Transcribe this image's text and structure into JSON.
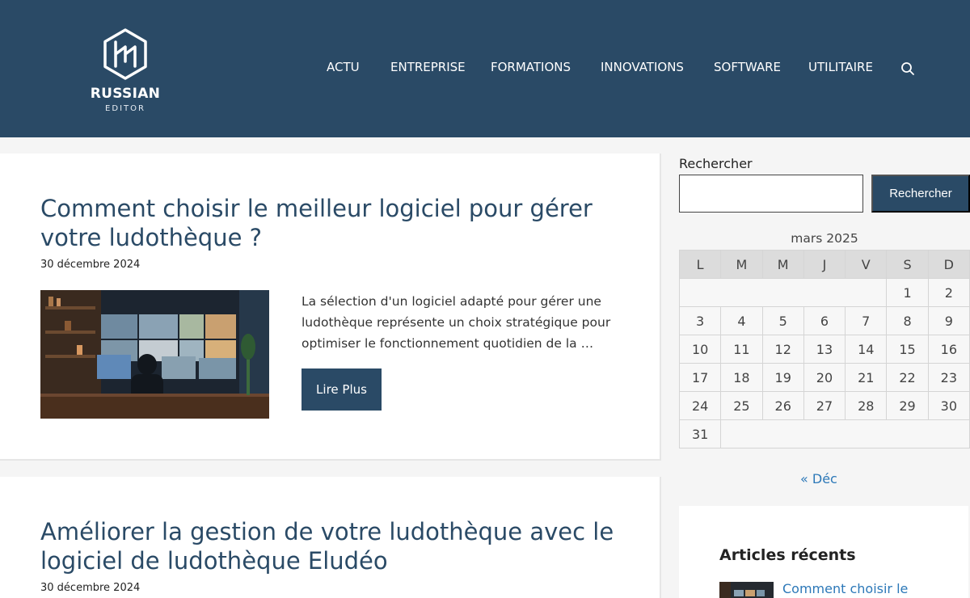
{
  "site": {
    "logo_name": "RUSSIAN",
    "logo_sub": "EDITOR",
    "colors": {
      "header_bg": "#2a4a66",
      "title": "#2a4a66",
      "link": "#2c78b8"
    }
  },
  "nav": {
    "items": [
      "ACTU",
      "ENTREPRISE",
      "FORMATIONS",
      "INNOVATIONS",
      "SOFTWARE",
      "UTILITAIRE"
    ],
    "search_icon": "search-icon"
  },
  "articles": [
    {
      "title": "Comment choisir le meilleur logiciel pour gérer votre ludothèque ?",
      "date": "30 décembre 2024",
      "excerpt": "La sélection d'un logiciel adapté pour gérer une ludothèque représente un choix stratégique pour optimiser le fonctionnement quotidien de la …",
      "read_more": "Lire Plus"
    },
    {
      "title": "Améliorer la gestion de votre ludothèque avec le logiciel de ludothèque Eludéo",
      "date": "30 décembre 2024"
    }
  ],
  "sidebar": {
    "search_label": "Rechercher",
    "search_button": "Rechercher",
    "calendar": {
      "caption": "mars 2025",
      "weekdays": [
        "L",
        "M",
        "M",
        "J",
        "V",
        "S",
        "D"
      ],
      "weeks": [
        [
          "",
          "",
          "",
          "",
          "",
          "1",
          "2"
        ],
        [
          "3",
          "4",
          "5",
          "6",
          "7",
          "8",
          "9"
        ],
        [
          "10",
          "11",
          "12",
          "13",
          "14",
          "15",
          "16"
        ],
        [
          "17",
          "18",
          "19",
          "20",
          "21",
          "22",
          "23"
        ],
        [
          "24",
          "25",
          "26",
          "27",
          "28",
          "29",
          "30"
        ],
        [
          "31",
          "",
          "",
          "",
          "",
          "",
          ""
        ]
      ],
      "prev_link": "« Déc"
    },
    "recent": {
      "title": "Articles récents",
      "first_link": "Comment choisir le"
    }
  }
}
